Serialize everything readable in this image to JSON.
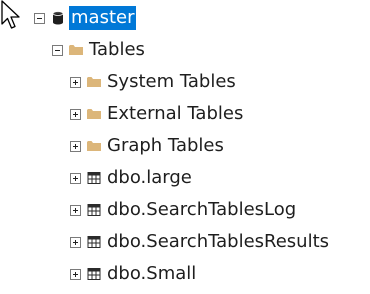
{
  "accent_color": "#0078d7",
  "tree": {
    "server": {
      "label": "master",
      "expanded": true,
      "icon": "database-icon"
    },
    "tables": {
      "label": "Tables",
      "expanded": true,
      "icon": "folder-icon"
    },
    "children": [
      {
        "label": "System Tables",
        "icon": "folder-icon"
      },
      {
        "label": "External Tables",
        "icon": "folder-icon"
      },
      {
        "label": "Graph Tables",
        "icon": "folder-icon"
      },
      {
        "label": "dbo.large",
        "icon": "table-icon"
      },
      {
        "label": "dbo.SearchTablesLog",
        "icon": "table-icon"
      },
      {
        "label": "dbo.SearchTablesResults",
        "icon": "table-icon"
      },
      {
        "label": "dbo.Small",
        "icon": "table-icon"
      }
    ]
  }
}
